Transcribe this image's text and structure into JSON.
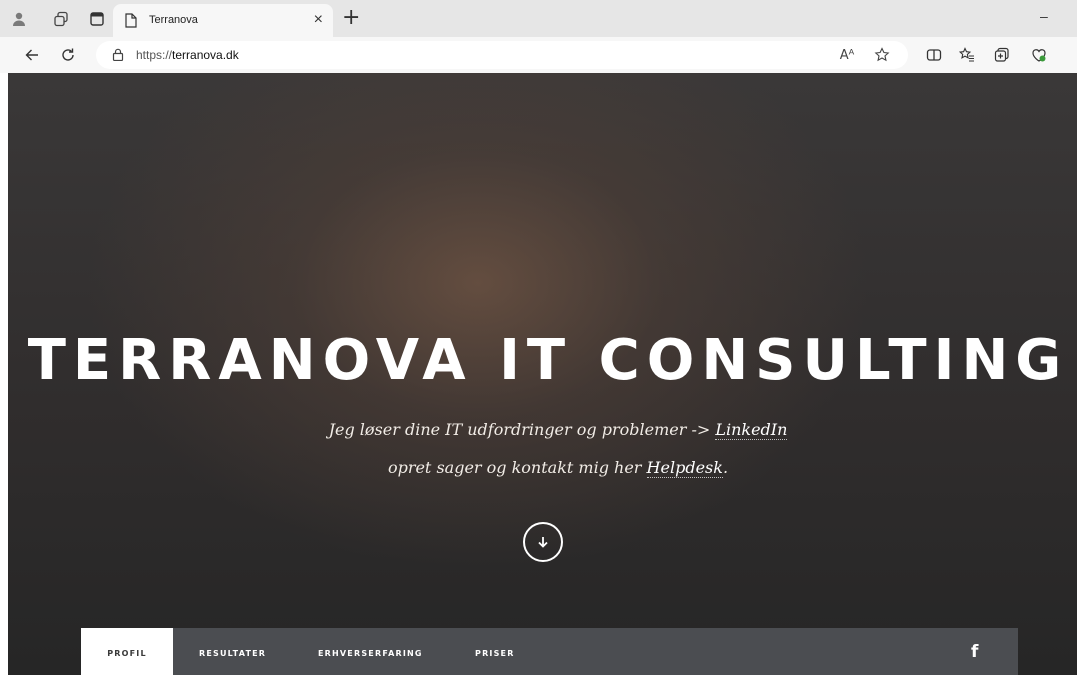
{
  "browser": {
    "tab": {
      "title": "Terranova",
      "close_glyph": "×"
    },
    "new_tab_glyph": "+",
    "minimize_glyph": "–",
    "address": {
      "scheme": "https://",
      "host": "terranova.dk"
    },
    "read_aloud_label": "Aᴬ"
  },
  "hero": {
    "title": "TERRANOVA IT CONSULTING",
    "line1_text": "Jeg løser dine IT udfordringer og problemer -> ",
    "line1_link": "LinkedIn",
    "line2_text": "opret sager og kontakt mig her ",
    "line2_link": "Helpdesk",
    "line2_end": "."
  },
  "section_nav": {
    "items": [
      {
        "label": "PROFIL",
        "active": true
      },
      {
        "label": "RESULTATER",
        "active": false
      },
      {
        "label": "ERHVERSERFARING",
        "active": false
      },
      {
        "label": "PRISER",
        "active": false
      }
    ],
    "social_icon": "facebook-icon"
  },
  "colors": {
    "hero_background": "#2e2b2b",
    "nav_background": "#4b4d51",
    "nav_active": "#ffffff"
  }
}
